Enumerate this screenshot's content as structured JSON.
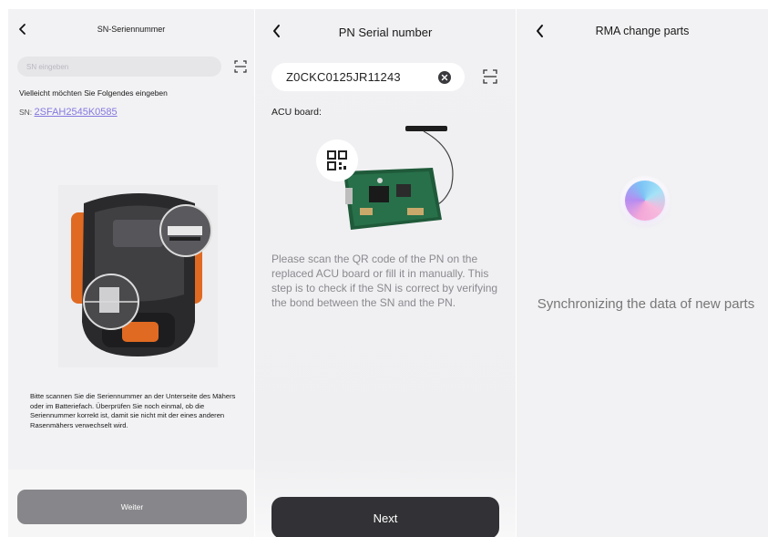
{
  "screen_sn": {
    "title": "SN-Seriennummer",
    "input_placeholder": "SN eingeben",
    "suggestion_text": "Vielleicht möchten Sie Folgendes eingeben",
    "sn_prefix": "SN: ",
    "sn_suggestion": "2SFAH2545K0585",
    "description": "Bitte scannen Sie die Seriennummer an der Unterseite des Mähers oder im Batteriefach. Überprüfen Sie noch einmal, ob die Seriennummer korrekt ist, damit sie nicht mit der eines anderen Rasenmähers verwechselt wird.",
    "button_label": "Weiter",
    "image_name": "mower-underside-image",
    "button_color": "#87878b",
    "link_color": "#8478e0"
  },
  "screen_pn": {
    "title": "PN Serial number",
    "input_value": "Z0CKC0125JR11243",
    "board_label": "ACU board:",
    "description": "Please scan the QR code of the PN on the replaced ACU board or fill it in manually. This step is to check if the SN is correct by verifying the bond between the SN and the PN.",
    "button_label": "Next",
    "icons": [
      "back-chevron-icon",
      "clear-icon",
      "scan-icon",
      "qr-code-icon"
    ],
    "button_color": "#323236"
  },
  "screen_rma": {
    "title": "RMA change parts",
    "status_text": "Synchronizing the data of new parts",
    "icons": [
      "back-chevron-icon",
      "loading-orb-icon"
    ]
  }
}
